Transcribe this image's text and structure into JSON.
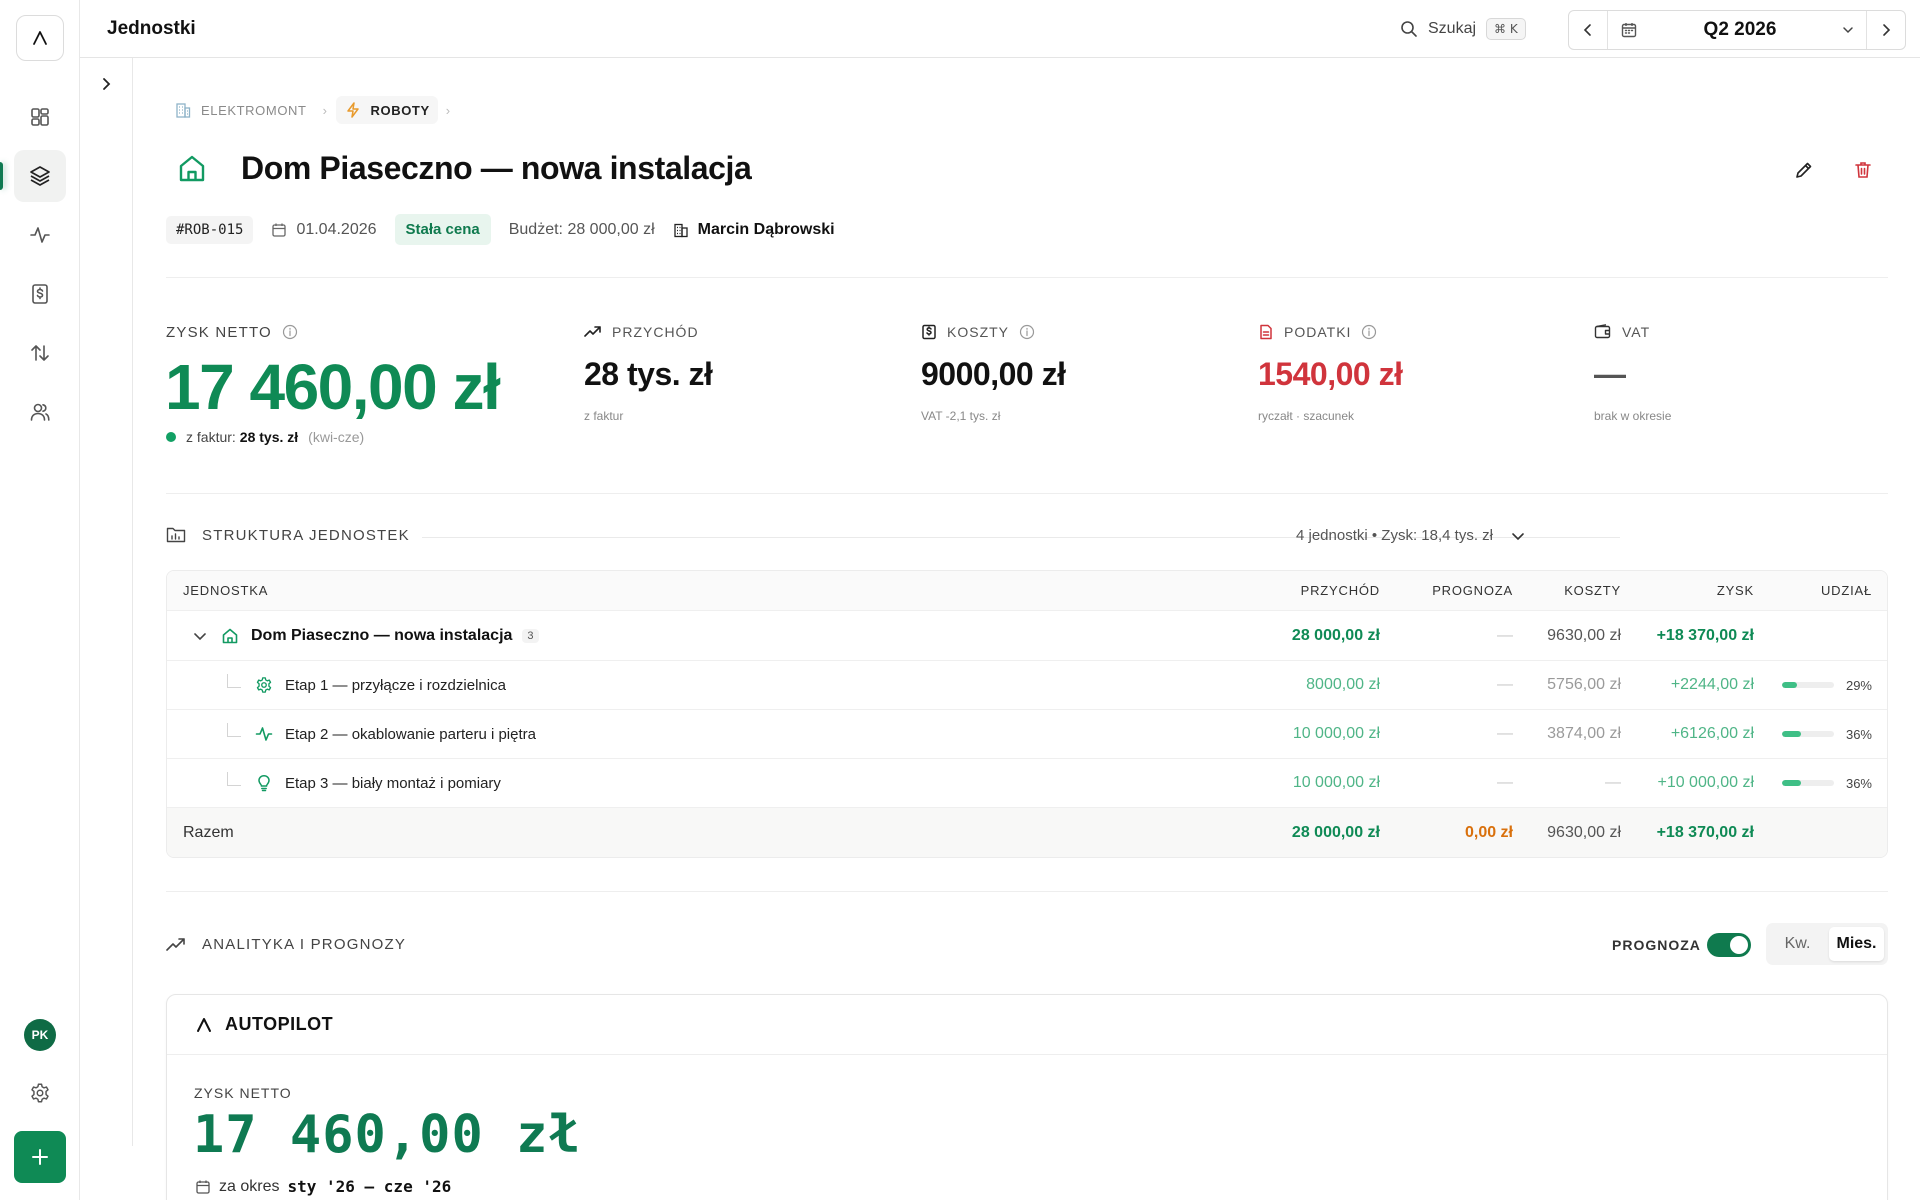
{
  "topbar": {
    "page_name": "Jednostki",
    "search_label": "Szukaj",
    "search_shortcut": "⌘ K",
    "period": "Q2 2026"
  },
  "breadcrumb": [
    {
      "label": "ELEKTROMONT"
    },
    {
      "label": "ROBOTY"
    }
  ],
  "title": "Dom Piaseczno — nowa instalacja",
  "meta": {
    "code": "#ROB-015",
    "date": "01.04.2026",
    "pricing": "Stała cena",
    "budget": "Budżet: 28 000,00 zł",
    "owner": "Marcin Dąbrowski"
  },
  "kpis": {
    "net_profit": {
      "label": "ZYSK NETTO",
      "value": "17 460,00 zł",
      "sub_prefix": "z faktur:",
      "sub_value": "28 tys. zł",
      "sub_range": "(kwi-cze)"
    },
    "revenue": {
      "label": "PRZYCHÓD",
      "value": "28 tys. zł",
      "sub": "z faktur"
    },
    "costs": {
      "label": "KOSZTY",
      "value": "9000,00 zł",
      "sub": "VAT -2,1 tys. zł"
    },
    "taxes": {
      "label": "PODATKI",
      "value": "1540,00 zł",
      "sub": "ryczałt · szacunek"
    },
    "vat": {
      "label": "VAT",
      "value": "—",
      "sub": "brak w okresie"
    }
  },
  "structure": {
    "title": "STRUKTURA JEDNOSTEK",
    "summary": "4 jednostki • Zysk: 18,4 tys. zł",
    "columns": [
      "JEDNOSTKA",
      "PRZYCHÓD",
      "PROGNOZA",
      "KOSZTY",
      "ZYSK",
      "UDZIAŁ"
    ],
    "parent": {
      "name": "Dom Piaseczno — nowa instalacja",
      "count": "3",
      "revenue": "28 000,00 zł",
      "forecast": "—",
      "costs": "9630,00 zł",
      "profit": "+18 370,00 zł"
    },
    "children": [
      {
        "name": "Etap 1 — przyłącze i rozdzielnica",
        "icon": "gear-icon",
        "revenue": "8000,00 zł",
        "forecast": "—",
        "costs": "5756,00 zł",
        "profit": "+2244,00 zł",
        "share": "29%",
        "share_fraction": 0.29
      },
      {
        "name": "Etap 2 — okablowanie parteru i piętra",
        "icon": "activity-icon",
        "revenue": "10 000,00 zł",
        "forecast": "—",
        "costs": "3874,00 zł",
        "profit": "+6126,00 zł",
        "share": "36%",
        "share_fraction": 0.36
      },
      {
        "name": "Etap 3 — biały montaż i pomiary",
        "icon": "lightbulb-icon",
        "revenue": "10 000,00 zł",
        "forecast": "—",
        "costs": "—",
        "profit": "+10 000,00 zł",
        "share": "36%",
        "share_fraction": 0.36
      }
    ],
    "total": {
      "label": "Razem",
      "revenue": "28 000,00 zł",
      "forecast": "0,00 zł",
      "costs": "9630,00 zł",
      "profit": "+18 370,00 zł"
    }
  },
  "analytics": {
    "title": "ANALITYKA I PROGNOZY",
    "forecast_toggle_label": "PROGNOZA",
    "forecast_enabled": true,
    "granularity": [
      "Kw.",
      "Mies."
    ],
    "granularity_selected": "Mies."
  },
  "autopilot": {
    "title": "AUTOPILOT",
    "label": "ZYSK NETTO",
    "value": "17 460,00 zł",
    "period_prefix": "za okres",
    "period": "sty '26 – cze '26"
  },
  "user": {
    "initials": "PK"
  },
  "colors": {
    "accent": "#0f8a55",
    "negative": "#d0343c",
    "warning": "#d9700c"
  }
}
